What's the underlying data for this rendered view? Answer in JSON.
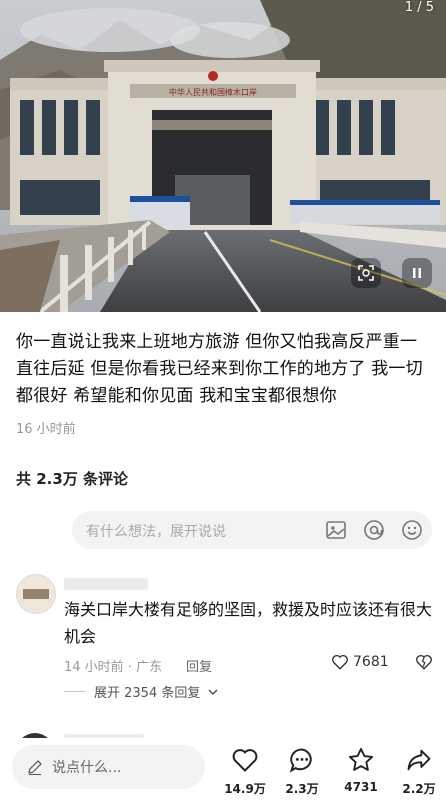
{
  "photo": {
    "counter": "1 / 5",
    "building_sign": "中华人民共和国樟木口岸"
  },
  "post": {
    "caption": "你一直说让我来上班地方旅游 但你又怕我高反严重一直往后延 但是你看我已经来到你工作的地方了 我一切都很好  希望能和你见面 我和宝宝都很想你",
    "time": "16 小时前"
  },
  "comments_header": {
    "label": "共 2.3万 条评论"
  },
  "comment_input": {
    "placeholder": "有什么想法，展开说说"
  },
  "comment": {
    "text": "海关口岸大楼有足够的坚固，救援及时应该还有很大机会",
    "meta": "14 小时前 · 广东",
    "reply": "回复",
    "likes": "7681",
    "expand": "展开 2354 条回复"
  },
  "bottom_bar": {
    "placeholder": "说点什么...",
    "likes": "14.9万",
    "comments": "2.3万",
    "favorites": "4731",
    "shares": "2.2万"
  }
}
